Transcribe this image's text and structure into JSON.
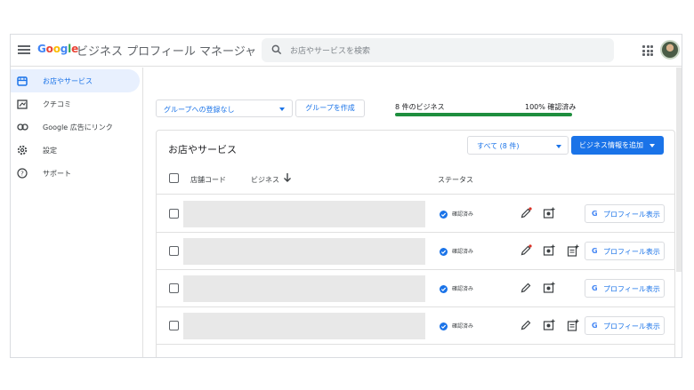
{
  "header": {
    "logo": [
      "G",
      "o",
      "o",
      "g",
      "l",
      "e"
    ],
    "app_title": "ビジネス プロフィール マネージャ",
    "search_placeholder": "お店やサービスを検索"
  },
  "sidebar": {
    "items": [
      {
        "label": "お店やサービス",
        "icon": "storefront-icon",
        "active": true
      },
      {
        "label": "クチコミ",
        "icon": "reviews-icon",
        "active": false
      },
      {
        "label": "Google 広告にリンク",
        "icon": "link-icon",
        "active": false
      },
      {
        "label": "設定",
        "icon": "gear-icon",
        "active": false
      },
      {
        "label": "サポート",
        "icon": "help-icon",
        "active": false
      }
    ]
  },
  "toolbar": {
    "group_select": "グループへの登録なし",
    "create_group": "グループを作成",
    "business_count": "8 件のビジネス",
    "verified_pct_label": "100% 確認済み",
    "verified_fraction": 1.0
  },
  "card": {
    "title": "お店やサービス",
    "filter_label": "すべて (8 件)",
    "add_button": "ビジネス情報を追加",
    "columns": {
      "store_code": "店舗コード",
      "business": "ビジネス",
      "status": "ステータス"
    }
  },
  "rows": [
    {
      "status": "確認済み",
      "profile_button": "プロフィール表示",
      "has_post_icon": false
    },
    {
      "status": "確認済み",
      "profile_button": "プロフィール表示",
      "has_post_icon": true
    },
    {
      "status": "確認済み",
      "profile_button": "プロフィール表示",
      "has_post_icon": false
    },
    {
      "status": "確認済み",
      "profile_button": "プロフィール表示",
      "has_post_icon": true
    }
  ],
  "colors": {
    "accent": "#1a73e8",
    "progress": "#1e8e3e",
    "active_nav_bg": "#e8f0fe"
  }
}
